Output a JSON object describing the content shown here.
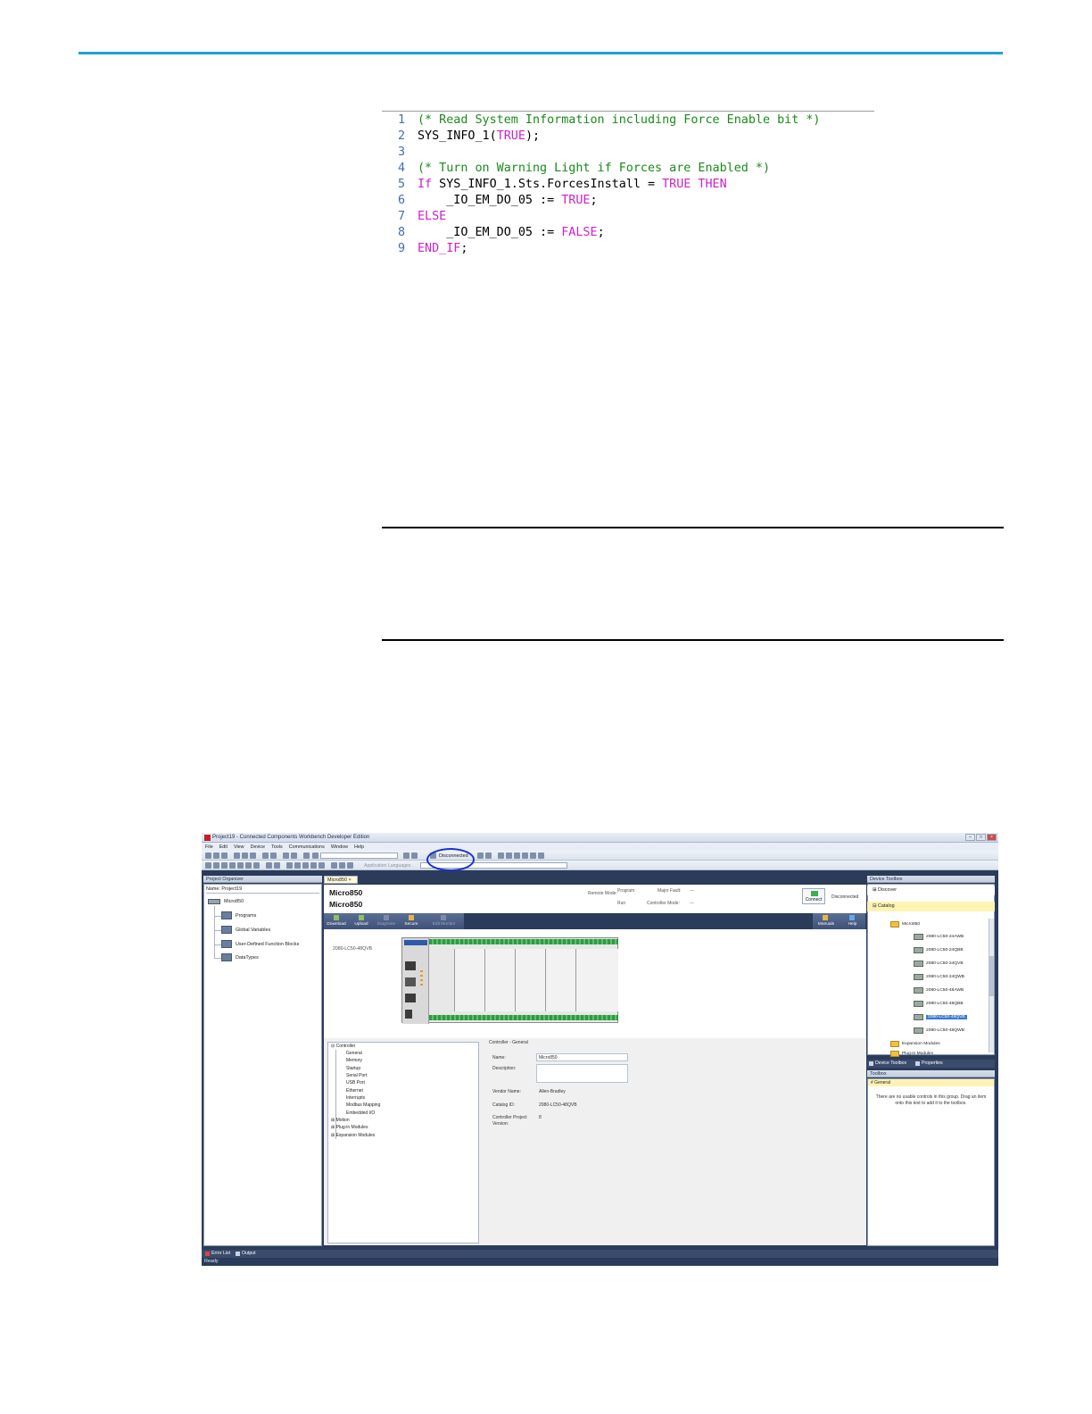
{
  "code": {
    "lines": [
      {
        "n": "1",
        "parts": [
          {
            "t": "(* Read System Information including Force Enable bit *)",
            "c": "comment"
          }
        ]
      },
      {
        "n": "2",
        "parts": [
          {
            "t": "SYS_INFO_1(",
            "c": "id"
          },
          {
            "t": "TRUE",
            "c": "kw"
          },
          {
            "t": ");",
            "c": "id"
          }
        ]
      },
      {
        "n": "3",
        "parts": []
      },
      {
        "n": "4",
        "parts": [
          {
            "t": "(* Turn on Warning Light if Forces are Enabled *)",
            "c": "comment"
          }
        ]
      },
      {
        "n": "5",
        "parts": [
          {
            "t": "If",
            "c": "kw"
          },
          {
            "t": " SYS_INFO_1.Sts.ForcesInstall = ",
            "c": "id"
          },
          {
            "t": "TRUE",
            "c": "kw"
          },
          {
            "t": " ",
            "c": "id"
          },
          {
            "t": "THEN",
            "c": "kw"
          }
        ]
      },
      {
        "n": "6",
        "parts": [
          {
            "t": "    _IO_EM_DO_05 := ",
            "c": "id"
          },
          {
            "t": "TRUE",
            "c": "kw"
          },
          {
            "t": ";",
            "c": "id"
          }
        ]
      },
      {
        "n": "7",
        "parts": [
          {
            "t": "ELSE",
            "c": "kw"
          }
        ]
      },
      {
        "n": "8",
        "parts": [
          {
            "t": "    _IO_EM_DO_05 := ",
            "c": "id"
          },
          {
            "t": "FALSE",
            "c": "kw"
          },
          {
            "t": ";",
            "c": "id"
          }
        ]
      },
      {
        "n": "9",
        "parts": [
          {
            "t": "END_IF",
            "c": "kw"
          },
          {
            "t": ";",
            "c": "id"
          }
        ]
      }
    ]
  },
  "screenshot": {
    "title": "Project19 - Connected Components Workbench Developer Edition",
    "menu": [
      "File",
      "Edit",
      "View",
      "Device",
      "Tools",
      "Communications",
      "Window",
      "Help"
    ],
    "connection_status": "Disconnected",
    "app_language": "Application Languages",
    "organizer": {
      "header": "Project Organizer",
      "name_label": "Name: Project19",
      "root": "Micro850",
      "items": [
        "Programs",
        "Global Variables",
        "User-Defined Function Blocks",
        "DataTypes"
      ]
    },
    "tab": "Micro850",
    "controller": {
      "title": "Micro850",
      "subtitle": "Micro850",
      "remote_mode": "Remote Mode:",
      "program": "Program",
      "run": "Run",
      "major_fault_label": "Major Fault:",
      "major_fault": "---",
      "controller_mode_label": "Controller Mode:",
      "controller_mode": "---",
      "connect": "Connect",
      "status": "Disconnected"
    },
    "actions": [
      "Download",
      "Upload",
      "Diagnose",
      "Secure",
      "Edit Monitor"
    ],
    "actions_right": [
      "Manuals",
      "Help"
    ],
    "device_model": "2080-LC50-48QVB",
    "cfg_tree": [
      "Controller",
      "General",
      "Memory",
      "Startup",
      "Serial Port",
      "USB Port",
      "Ethernet",
      "Interrupts",
      "Modbus Mapping",
      "Embedded I/O",
      "Motion",
      "Plug-in Modules",
      "Expansion Modules"
    ],
    "cfg_form": {
      "heading": "Controller - General",
      "name_label": "Name:",
      "name_value": "Micro850",
      "description_label": "Description:",
      "vendor_label": "Vendor Name:",
      "vendor_value": "Allen-Bradley",
      "catalog_label": "Catalog ID:",
      "catalog_value": "2080-LC50-48QVB",
      "version_label_1": "Controller Project",
      "version_label_2": "Version:",
      "version_value": "8"
    },
    "device_toolbox": {
      "header": "Device Toolbox",
      "discover": "Discover",
      "catalog": "Catalog",
      "folder": "Micro850",
      "items": [
        "2080-LC50-24AWB",
        "2080-LC50-24QBB",
        "2080-LC50-24QVB",
        "2080-LC50-24QWB",
        "2080-LC50-48AWB",
        "2080-LC50-48QBB",
        "2080-LC50-48QVB",
        "2080-LC50-48QWB"
      ],
      "selected_index": 6,
      "expansion": "Expansion Modules",
      "plugin": "Plug-in Modules",
      "tab_device": "Device Toolbox",
      "tab_properties": "Properties"
    },
    "toolbox": {
      "header": "Toolbox",
      "group": "# General",
      "message": "There are no usable controls in this group. Drag an item onto this text to add it to the toolbox."
    },
    "bottom_tabs": [
      "Error List",
      "Output"
    ],
    "status": "Ready"
  }
}
